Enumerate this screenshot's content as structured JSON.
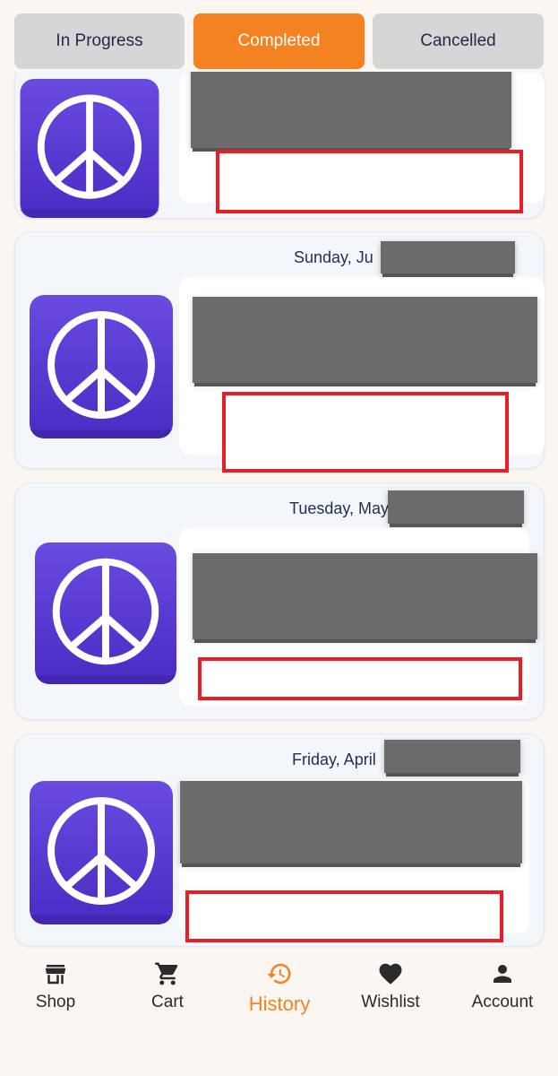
{
  "tabs": [
    {
      "label": "In Progress",
      "active": false
    },
    {
      "label": "Completed",
      "active": true
    },
    {
      "label": "Cancelled",
      "active": false
    }
  ],
  "orders": [
    {
      "date_visible": "",
      "icon": "peace-sign-icon"
    },
    {
      "date_visible": "Sunday, Ju",
      "icon": "peace-sign-icon"
    },
    {
      "date_visible": "Tuesday, May",
      "icon": "peace-sign-icon"
    },
    {
      "date_visible": "Friday, April",
      "icon": "peace-sign-icon"
    }
  ],
  "nav": [
    {
      "label": "Shop",
      "icon": "store-icon",
      "active": false
    },
    {
      "label": "Cart",
      "icon": "cart-icon",
      "active": false
    },
    {
      "label": "History",
      "icon": "history-icon",
      "active": true
    },
    {
      "label": "Wishlist",
      "icon": "heart-icon",
      "active": false
    },
    {
      "label": "Account",
      "icon": "account-icon",
      "active": false
    }
  ],
  "colors": {
    "accent": "#f58220",
    "tab_inactive": "#d6d6d6",
    "text_dark": "#1f2a4a",
    "icon_purple": "#5b3fd6",
    "redaction": "#6b6b6b",
    "annotation_red": "#ea1c24"
  }
}
